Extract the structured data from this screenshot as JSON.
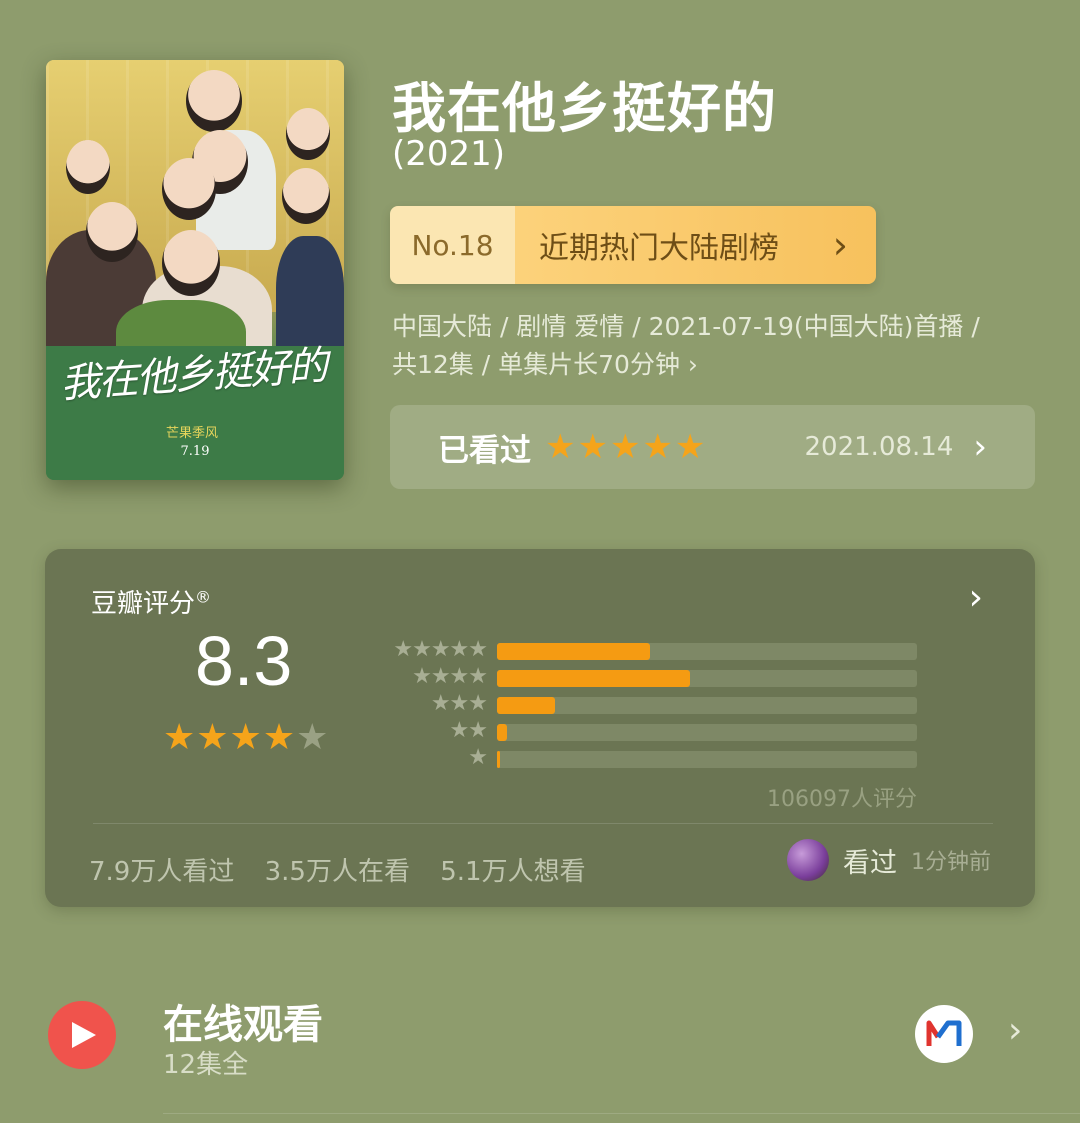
{
  "show": {
    "title": "我在他乡挺好的",
    "year": "(2021)",
    "poster": {
      "calligraphy": "我在他乡挺好的",
      "stamp": "芒果季风",
      "date": "7.19"
    }
  },
  "rank": {
    "number": "No.18",
    "list_name": "近期热门大陆剧榜",
    "chevron": "›"
  },
  "meta": {
    "line1": "中国大陆 / 剧情 爱情 / 2021-07-19(中国大陆)首播 /",
    "line2": "共12集 / 单集片长70分钟 ›"
  },
  "watched": {
    "label": "已看过",
    "stars": "★★★★★",
    "date": "2021.08.14",
    "chevron": "›"
  },
  "rating": {
    "header": "豆瓣评分",
    "registered": "®",
    "chevron": "›",
    "score": "8.3",
    "stars_on": "★★★★",
    "stars_off": "★",
    "distribution": [
      {
        "stars": "★★★★★",
        "fraction": 0.365
      },
      {
        "stars": "★★★★",
        "fraction": 0.46
      },
      {
        "stars": "★★★",
        "fraction": 0.138
      },
      {
        "stars": "★★",
        "fraction": 0.024
      },
      {
        "stars": "★",
        "fraction": 0.008
      }
    ],
    "count": "106097人评分",
    "stats": {
      "watched": "7.9万人看过",
      "watching": "3.5万人在看",
      "wish": "5.1万人想看"
    },
    "friend": {
      "action": "看过",
      "time": "1分钟前"
    }
  },
  "online": {
    "title": "在线观看",
    "subtitle": "12集全",
    "chevron": "›"
  },
  "colors": {
    "background": "#8e9c6d",
    "star": "#f5a41a",
    "play": "#f0534c",
    "rank_bg": "#f7c15d"
  }
}
